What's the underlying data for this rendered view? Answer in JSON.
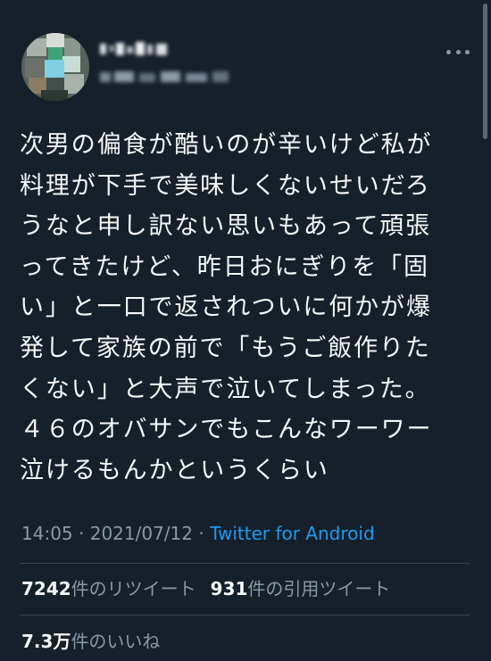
{
  "tweet": {
    "text_lines": [
      "次男の偏食が酷いのが辛いけど私が",
      "料理が下手で美味しくないせいだろ",
      "うなと申し訳ない思いもあって頑張",
      "ってきたけど、昨日おにぎりを「固",
      "い」と一口で返されついに何かが爆",
      "発して家族の前で「もうご飯作りた",
      "くない」と大声で泣いてしまった。",
      "４６のオバサンでもこんなワーワー",
      "泣けるもんかというくらい"
    ],
    "time": "14:05",
    "separator1": "·",
    "date": "2021/07/12",
    "separator2": "·",
    "source": "Twitter for Android"
  },
  "stats": {
    "retweets_count": "7242",
    "retweets_label": "件のリツイート",
    "quotes_count": "931",
    "quotes_label": "件の引用ツイート",
    "likes_count": "7.3万",
    "likes_label": "件のいいね"
  },
  "colors": {
    "background": "#15202b",
    "text": "#f7f9f9",
    "secondary": "#8b98a5",
    "link": "#1d9bf0",
    "divider": "#38444d"
  },
  "icons": {
    "more": "more-horizontal-icon"
  }
}
